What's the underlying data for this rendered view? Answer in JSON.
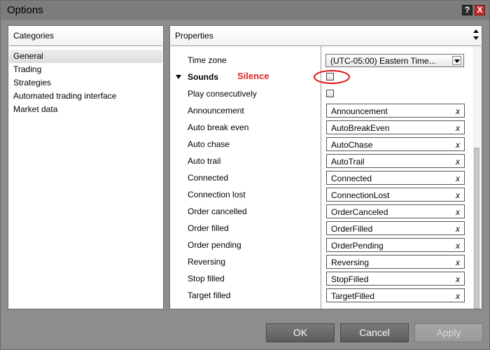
{
  "window": {
    "title": "Options",
    "help_glyph": "?",
    "close_glyph": "X"
  },
  "categories": {
    "header": "Categories",
    "items": [
      {
        "label": "General",
        "selected": true
      },
      {
        "label": "Trading",
        "selected": false
      },
      {
        "label": "Strategies",
        "selected": false
      },
      {
        "label": "Automated trading interface",
        "selected": false
      },
      {
        "label": "Market data",
        "selected": false
      }
    ]
  },
  "properties": {
    "header": "Properties",
    "time_zone": {
      "label": "Time zone",
      "value": "(UTC-05:00) Eastern Time..."
    },
    "sounds": {
      "label": "Sounds",
      "annotation": "Silence",
      "checked": false
    },
    "play_consecutively": {
      "label": "Play consecutively",
      "checked": false
    },
    "clear_glyph": "x",
    "sound_rows": [
      {
        "label": "Announcement",
        "value": "Announcement"
      },
      {
        "label": "Auto break even",
        "value": "AutoBreakEven"
      },
      {
        "label": "Auto chase",
        "value": "AutoChase"
      },
      {
        "label": "Auto trail",
        "value": "AutoTrail"
      },
      {
        "label": "Connected",
        "value": "Connected"
      },
      {
        "label": "Connection lost",
        "value": "ConnectionLost"
      },
      {
        "label": "Order cancelled",
        "value": "OrderCanceled"
      },
      {
        "label": "Order filled",
        "value": "OrderFilled"
      },
      {
        "label": "Order pending",
        "value": "OrderPending"
      },
      {
        "label": "Reversing",
        "value": "Reversing"
      },
      {
        "label": "Stop filled",
        "value": "StopFilled"
      },
      {
        "label": "Target filled",
        "value": "TargetFilled"
      }
    ]
  },
  "buttons": {
    "ok": "OK",
    "cancel": "Cancel",
    "apply": "Apply"
  },
  "colors": {
    "annotation": "#e02424",
    "highlight_ellipse": "#e01010"
  }
}
